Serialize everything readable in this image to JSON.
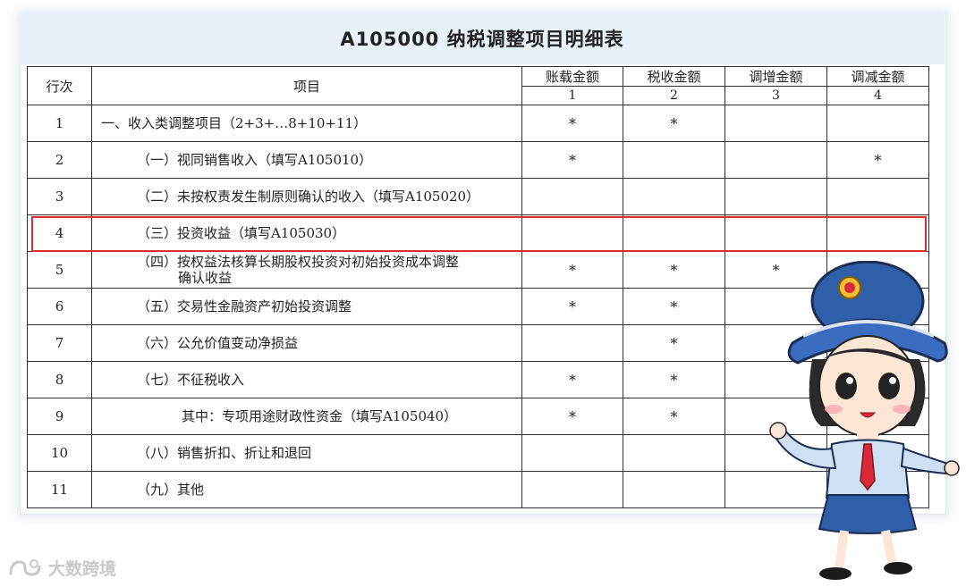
{
  "doc": {
    "title": "A105000 纳税调整项目明细表"
  },
  "table": {
    "col_row_no": "行次",
    "col_item": "项目",
    "value_columns": [
      {
        "label": "账载金额",
        "num": "1"
      },
      {
        "label": "税收金额",
        "num": "2"
      },
      {
        "label": "调增金额",
        "num": "3"
      },
      {
        "label": "调减金额",
        "num": "4"
      }
    ],
    "rows": [
      {
        "no": "1",
        "item": "一、收入类调整项目（2+3+…8+10+11）",
        "v1": "*",
        "v2": "*",
        "v3": "",
        "v4": ""
      },
      {
        "no": "2",
        "item": "（一）视同销售收入（填写A105010）",
        "v1": "*",
        "v2": "",
        "v3": "",
        "v4": "*"
      },
      {
        "no": "3",
        "item": "（二）未按权责发生制原则确认的收入（填写A105020）",
        "v1": "",
        "v2": "",
        "v3": "",
        "v4": ""
      },
      {
        "no": "4",
        "item": "（三）投资收益（填写A105030）",
        "v1": "",
        "v2": "",
        "v3": "",
        "v4": ""
      },
      {
        "no": "5",
        "item_line1": "（四）按权益法核算长期股权投资对初始投资成本调整",
        "item_line2": "确认收益",
        "v1": "*",
        "v2": "*",
        "v3": "*",
        "v4": ""
      },
      {
        "no": "6",
        "item": "（五）交易性金融资产初始投资调整",
        "v1": "*",
        "v2": "*",
        "v3": "",
        "v4": ""
      },
      {
        "no": "7",
        "item": "（六）公允价值变动净损益",
        "v1": "",
        "v2": "*",
        "v3": "",
        "v4": ""
      },
      {
        "no": "8",
        "item": "（七）不征税收入",
        "v1": "*",
        "v2": "*",
        "v3": "",
        "v4": ""
      },
      {
        "no": "9",
        "item": "其中：专项用途财政性资金（填写A105040）",
        "v1": "*",
        "v2": "*",
        "v3": "",
        "v4": ""
      },
      {
        "no": "10",
        "item": "（八）销售折扣、折让和退回",
        "v1": "",
        "v2": "",
        "v3": "",
        "v4": ""
      },
      {
        "no": "11",
        "item": "（九）其他",
        "v1": "",
        "v2": "",
        "v3": "",
        "v4": ""
      }
    ]
  },
  "watermark": {
    "text": "大数跨境"
  },
  "colors": {
    "title_bar_bg": "#e8f1fa",
    "highlight_border": "#e02b2b",
    "grid_line": "#333333",
    "mascot_hat": "#2f5fa8",
    "mascot_tie": "#d8283a"
  },
  "icons": {
    "mascot": "tax-officer-mascot",
    "watermark_logo": "dashujk-logo-icon",
    "hat_badge": "tax-emblem-icon"
  }
}
